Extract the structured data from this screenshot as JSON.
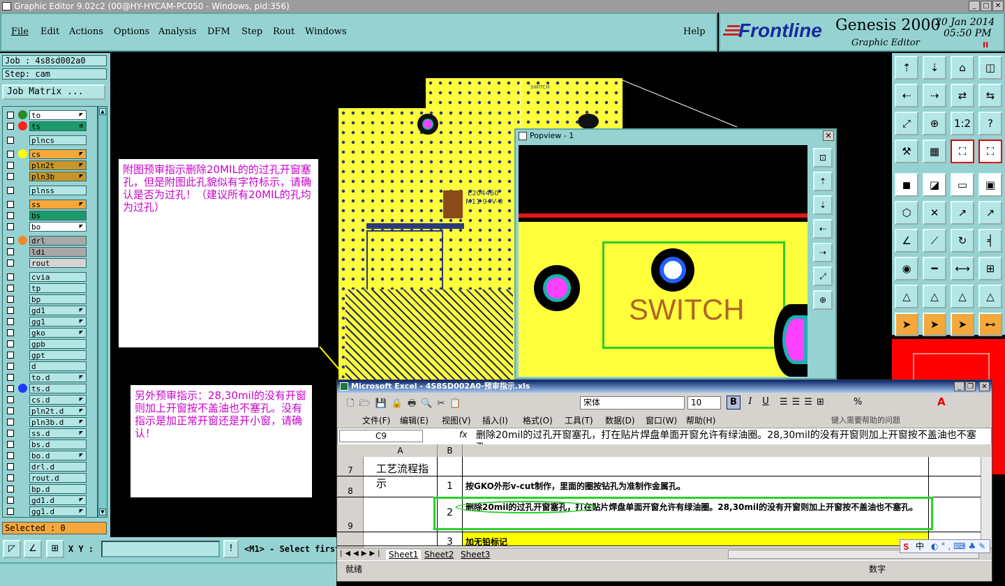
{
  "window": {
    "title": "Graphic Editor 9.02c2 (00@HY-HYCAM-PC050 - Windows, pid:356)"
  },
  "menu": {
    "items": [
      "File",
      "Edit",
      "Actions",
      "Options",
      "Analysis",
      "DFM",
      "Step",
      "Rout",
      "Windows"
    ],
    "help": "Help"
  },
  "brand": {
    "logo": "Frontline",
    "product": "Genesis 2000",
    "subtitle": "Graphic Editor",
    "date": "20 Jan 2014",
    "time": "05:50 PM",
    "pause": "II"
  },
  "job": {
    "job": "Job : 4s8sd002a0",
    "step": "Step: cam",
    "matrix": "Job Matrix ..."
  },
  "layers": [
    {
      "name": "to",
      "bg": "#ffffff",
      "dot": "#2a8a2a",
      "mark": "◤"
    },
    {
      "name": "ts",
      "bg": "#1c9a6a",
      "dot": "#ff2020",
      "mark": "⊞"
    },
    {
      "name": "plncs",
      "bg": "#b4e6e6",
      "dot": "",
      "mark": ""
    },
    {
      "name": "cs",
      "bg": "#f4a83c",
      "dot": "#ffff00",
      "mark": "◤"
    },
    {
      "name": "pln2t",
      "bg": "#c89628",
      "dot": "",
      "mark": "◤"
    },
    {
      "name": "pln3b",
      "bg": "#c89628",
      "dot": "",
      "mark": "◤"
    },
    {
      "name": "plnss",
      "bg": "#b4e6e6",
      "dot": "",
      "mark": ""
    },
    {
      "name": "ss",
      "bg": "#f4a83c",
      "dot": "",
      "mark": "◤"
    },
    {
      "name": "bs",
      "bg": "#1c9a6a",
      "dot": "",
      "mark": ""
    },
    {
      "name": "bo",
      "bg": "#ffffff",
      "dot": "",
      "mark": "◤"
    },
    {
      "name": "drl",
      "bg": "#a8a8a8",
      "dot": "#f08a28",
      "mark": ""
    },
    {
      "name": "ldi",
      "bg": "#a8a8a8",
      "dot": "",
      "mark": ""
    },
    {
      "name": "rout",
      "bg": "#d4d4d4",
      "dot": "",
      "mark": ""
    },
    {
      "name": "cvia",
      "bg": "#b4e6e6",
      "dot": "",
      "mark": ""
    },
    {
      "name": "tp",
      "bg": "#b4e6e6",
      "dot": "",
      "mark": ""
    },
    {
      "name": "bp",
      "bg": "#b4e6e6",
      "dot": "",
      "mark": ""
    },
    {
      "name": "gd1",
      "bg": "#b4e6e6",
      "dot": "",
      "mark": "◤"
    },
    {
      "name": "gg1",
      "bg": "#b4e6e6",
      "dot": "",
      "mark": "◤"
    },
    {
      "name": "gko",
      "bg": "#b4e6e6",
      "dot": "",
      "mark": "◤"
    },
    {
      "name": "gpb",
      "bg": "#b4e6e6",
      "dot": "",
      "mark": ""
    },
    {
      "name": "gpt",
      "bg": "#b4e6e6",
      "dot": "",
      "mark": ""
    },
    {
      "name": "d",
      "bg": "#b4e6e6",
      "dot": "",
      "mark": ""
    },
    {
      "name": "to.d",
      "bg": "#b4e6e6",
      "dot": "",
      "mark": "◤"
    },
    {
      "name": "ts.d",
      "bg": "#b4e6e6",
      "dot": "#1c3aff",
      "mark": ""
    },
    {
      "name": "cs.d",
      "bg": "#b4e6e6",
      "dot": "",
      "mark": "◤"
    },
    {
      "name": "pln2t.d",
      "bg": "#b4e6e6",
      "dot": "",
      "mark": "◤"
    },
    {
      "name": "pln3b.d",
      "bg": "#b4e6e6",
      "dot": "",
      "mark": "◤"
    },
    {
      "name": "ss.d",
      "bg": "#b4e6e6",
      "dot": "",
      "mark": "◤"
    },
    {
      "name": "bs.d",
      "bg": "#b4e6e6",
      "dot": "",
      "mark": ""
    },
    {
      "name": "bo.d",
      "bg": "#b4e6e6",
      "dot": "",
      "mark": "◤"
    },
    {
      "name": "drl.d",
      "bg": "#b4e6e6",
      "dot": "",
      "mark": ""
    },
    {
      "name": "rout.d",
      "bg": "#b4e6e6",
      "dot": "",
      "mark": ""
    },
    {
      "name": "bp.d",
      "bg": "#b4e6e6",
      "dot": "",
      "mark": ""
    },
    {
      "name": "gd1.d",
      "bg": "#b4e6e6",
      "dot": "",
      "mark": "◤"
    },
    {
      "name": "gg1.d",
      "bg": "#b4e6e6",
      "dot": "",
      "mark": "◤"
    }
  ],
  "selected": "Selected : 0",
  "bottom": {
    "xy_label": "X Y :",
    "xy_value": "",
    "message": "<M1> - Select first"
  },
  "notes": {
    "note1": "附图预审指示删除20MIL的的过孔开窗塞孔，但是附图此孔貌似有字符标示，请确认是否为过孔！（建议所有20MIL的孔均为过孔）",
    "note2": "另外预审指示：28,30mil的没有开窗则加上开窗按不盖油也不塞孔。没有指示是加正常开窗还是开小窗，请确认！"
  },
  "board": {
    "marking1": "E204460",
    "marking2": "M11 94V-0",
    "switch_small": "SWITCH"
  },
  "popview": {
    "title": "Popview - 1",
    "label": "SWITCH"
  },
  "excel": {
    "title": "Microsoft Excel - 4S8SD002A0-预审指示.xls",
    "font": "宋体",
    "size": "10",
    "menus": [
      "文件(F)",
      "编辑(E)",
      "视图(V)",
      "插入(I)",
      "格式(O)",
      "工具(T)",
      "数据(D)",
      "窗口(W)",
      "帮助(H)"
    ],
    "help_placeholder": "键入需要帮助的问题",
    "cell_ref": "C9",
    "fx": "fx",
    "formula": "删除20mil的过孔开窗塞孔，打在贴片焊盘单面开窗允许有绿油圈。28,30mil的没有开窗则加上开窗按不盖油也不塞孔。",
    "col_a": "A",
    "col_b": "B",
    "rows": [
      {
        "num": "7",
        "a": "工艺流程指示",
        "b": "",
        "c": ""
      },
      {
        "num": "8",
        "a": "",
        "b": "1",
        "c": "按GKO外形v-cut制作，里面的圈按钻孔为准制作金属孔。"
      },
      {
        "num": "9",
        "a": "",
        "b": "2",
        "c": "删除20mil的过孔开窗塞孔，打在贴片焊盘单面开窗允许有绿油圈。28,30mil的没有开窗则加上开窗按不盖油也不塞孔。"
      },
      {
        "num": "",
        "a": "",
        "b": "3",
        "c": "加无铅标记"
      }
    ],
    "sheets": [
      "Sheet1",
      "Sheet2",
      "Sheet3"
    ],
    "status": "就绪",
    "status_right": "数字",
    "ime": "中"
  }
}
